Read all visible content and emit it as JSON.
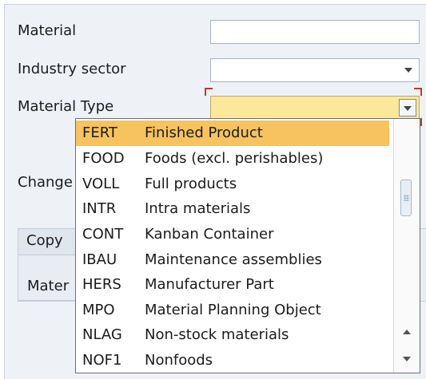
{
  "form": {
    "material_label": "Material",
    "material_value": "",
    "industry_sector_label": "Industry sector",
    "industry_sector_value": "",
    "material_type_label": "Material Type",
    "material_type_value": "",
    "change_label_partial": "Change"
  },
  "copy_section": {
    "tab_label_partial": "Copy",
    "field_label_partial": "Mater"
  },
  "dropdown": {
    "highlight_color": "#f7c35f",
    "items": [
      {
        "code": "FERT",
        "description": "Finished Product"
      },
      {
        "code": "FOOD",
        "description": "Foods (excl. perishables)"
      },
      {
        "code": "VOLL",
        "description": "Full products"
      },
      {
        "code": "INTR",
        "description": "Intra materials"
      },
      {
        "code": "CONT",
        "description": "Kanban Container"
      },
      {
        "code": "IBAU",
        "description": "Maintenance assemblies"
      },
      {
        "code": "HERS",
        "description": "Manufacturer Part"
      },
      {
        "code": "MPO",
        "description": "Material Planning Object"
      },
      {
        "code": "NLAG",
        "description": "Non-stock materials"
      },
      {
        "code": "NOF1",
        "description": "Nonfoods"
      }
    ],
    "selected_index": 0
  }
}
